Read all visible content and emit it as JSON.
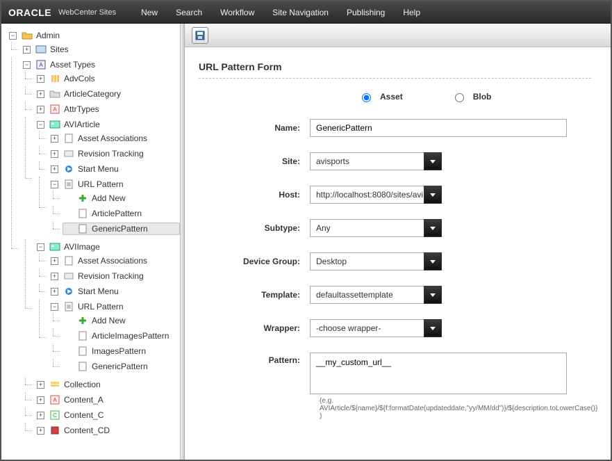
{
  "brand": {
    "name": "ORACLE",
    "product": "WebCenter Sites"
  },
  "menu": {
    "new": "New",
    "search": "Search",
    "workflow": "Workflow",
    "siteNav": "Site Navigation",
    "publishing": "Publishing",
    "help": "Help"
  },
  "tree": {
    "root": "Admin",
    "sites": "Sites",
    "assetTypes": "Asset Types",
    "advCols": "AdvCols",
    "articleCategory": "ArticleCategory",
    "attrTypes": "AttrTypes",
    "aviArticle": "AVIArticle",
    "assetAssoc": "Asset Associations",
    "revTrack": "Revision Tracking",
    "startMenu": "Start Menu",
    "urlPattern": "URL Pattern",
    "addNew": "Add New",
    "articlePattern": "ArticlePattern",
    "genericPattern": "GenericPattern",
    "aviImage": "AVIImage",
    "articleImagesPattern": "ArticleImagesPattern",
    "imagesPattern": "ImagesPattern",
    "collection": "Collection",
    "contentA": "Content_A",
    "contentC": "Content_C",
    "contentCD": "Content_CD"
  },
  "form": {
    "title": "URL Pattern Form",
    "radio": {
      "asset": "Asset",
      "blob": "Blob",
      "selected": "asset"
    },
    "labels": {
      "name": "Name:",
      "site": "Site:",
      "host": "Host:",
      "subtype": "Subtype:",
      "deviceGroup": "Device Group:",
      "template": "Template:",
      "wrapper": "Wrapper:",
      "pattern": "Pattern:"
    },
    "values": {
      "name": "GenericPattern",
      "site": "avisports",
      "host": "http://localhost:8080/sites/avi",
      "subtype": "Any",
      "deviceGroup": "Desktop",
      "template": "defaultassettemplate",
      "wrapper": "-choose wrapper-",
      "pattern": "__my_custom_url__"
    },
    "helper": "(e.g. AVIArticle/${name}/${f:formatDate(updateddate,\"yy/MM/dd\")}/${description.toLowerCase()} )"
  },
  "icons": {
    "chevron": "chevron-down"
  }
}
